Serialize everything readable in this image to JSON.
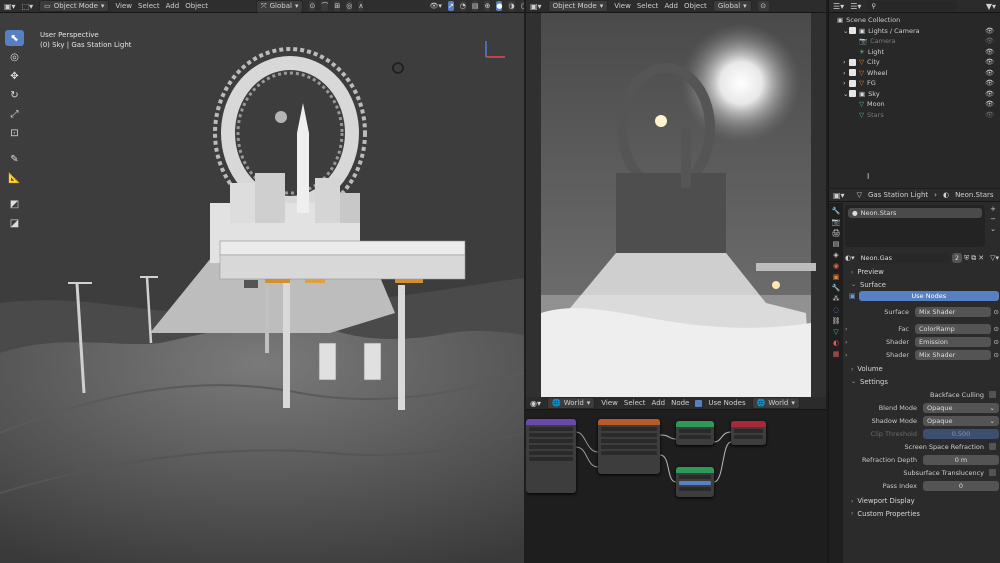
{
  "left_header": {
    "mode": "Object Mode",
    "menus": [
      "View",
      "Select",
      "Add",
      "Object"
    ],
    "orientation": "Global"
  },
  "left_viewport": {
    "perspective": "User Perspective",
    "context": "(0) Sky | Gas Station Light"
  },
  "mid_header": {
    "mode": "Object Mode",
    "menus": [
      "View",
      "Select",
      "Add",
      "Object"
    ],
    "orientation": "Global"
  },
  "node_header": {
    "world_label": "World",
    "menus": [
      "View",
      "Select",
      "Add",
      "Node"
    ],
    "use_nodes_label": "Use Nodes",
    "world_name": "World"
  },
  "outliner": {
    "search_placeholder": "",
    "root": "Scene Collection",
    "items": [
      {
        "label": "Lights / Camera",
        "indent": 1,
        "expanded": true
      },
      {
        "label": "Camera",
        "indent": 2,
        "dim": true
      },
      {
        "label": "Light",
        "indent": 2
      },
      {
        "label": "City",
        "indent": 1
      },
      {
        "label": "Wheel",
        "indent": 1
      },
      {
        "label": "FG",
        "indent": 1
      },
      {
        "label": "Sky",
        "indent": 1,
        "expanded": true
      },
      {
        "label": "Moon",
        "indent": 2
      },
      {
        "label": "Stars",
        "indent": 2,
        "dim": true
      }
    ]
  },
  "properties": {
    "breadcrumb_object": "Gas Station Light",
    "breadcrumb_material": "Neon.Stars",
    "slot_name": "Neon.Stars",
    "material_name": "Neon.Gas",
    "users": "2",
    "panels": {
      "preview": "Preview",
      "surface": "Surface",
      "volume": "Volume",
      "settings": "Settings",
      "viewport_display": "Viewport Display",
      "custom_properties": "Custom Properties"
    },
    "use_nodes_button": "Use Nodes",
    "surface_rows": [
      {
        "label": "Surface",
        "value": "Mix Shader"
      },
      {
        "label": "Fac",
        "value": "ColorRamp"
      },
      {
        "label": "Shader",
        "value": "Emission"
      },
      {
        "label": "Shader",
        "value": "Mix Shader"
      }
    ],
    "backface_culling": "Backface Culling",
    "blend_mode_label": "Blend Mode",
    "blend_mode": "Opaque",
    "shadow_mode_label": "Shadow Mode",
    "shadow_mode": "Opaque",
    "clip_threshold_label": "Clip Threshold",
    "clip_threshold": "0.500",
    "screen_space_refraction": "Screen Space Refraction",
    "refraction_depth_label": "Refraction Depth",
    "refraction_depth": "0 m",
    "subsurface_translucency": "Subsurface Translucency",
    "pass_index_label": "Pass Index",
    "pass_index": "0"
  },
  "colors": {
    "accent": "#5680c2",
    "panel": "#2b2b2b",
    "outliner_orange": "#e8833a",
    "outliner_green": "#59c47b"
  }
}
